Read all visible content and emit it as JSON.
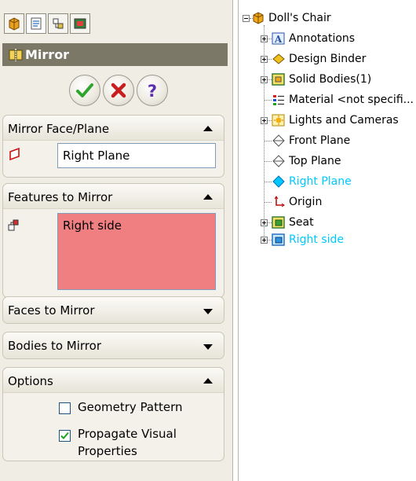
{
  "panel": {
    "tabs": [
      {
        "icon": "feature-manager-icon"
      },
      {
        "icon": "property-manager-icon"
      },
      {
        "icon": "configuration-manager-icon"
      },
      {
        "icon": "display-manager-icon"
      }
    ],
    "title": "Mirror",
    "actions": {
      "ok": "ok-icon",
      "cancel": "cancel-icon",
      "help": "help-icon"
    },
    "groups": {
      "mirror_face": {
        "label": "Mirror Face/Plane",
        "value": "Right Plane"
      },
      "features": {
        "label": "Features to Mirror",
        "value": "Right side"
      },
      "faces": {
        "label": "Faces to Mirror"
      },
      "bodies": {
        "label": "Bodies to Mirror"
      },
      "options": {
        "label": "Options",
        "geometry_pattern": {
          "label": "Geometry Pattern",
          "checked": false
        },
        "propagate": {
          "label_line1": "Propagate Visual",
          "label_line2": "Properties",
          "checked": true
        }
      }
    }
  },
  "tree": {
    "root": "Doll's Chair",
    "items": [
      {
        "label": "Annotations",
        "icon": "annotations-icon"
      },
      {
        "label": "Design Binder",
        "icon": "design-binder-icon"
      },
      {
        "label": "Solid Bodies(1)",
        "icon": "solid-bodies-icon"
      },
      {
        "label": "Material <not specifi...",
        "icon": "material-icon"
      },
      {
        "label": "Lights and Cameras",
        "icon": "lights-icon"
      },
      {
        "label": "Front Plane",
        "icon": "plane-icon"
      },
      {
        "label": "Top Plane",
        "icon": "plane-icon"
      },
      {
        "label": "Right Plane",
        "icon": "plane-icon"
      },
      {
        "label": "Origin",
        "icon": "origin-icon"
      },
      {
        "label": "Seat",
        "icon": "extrude-icon"
      },
      {
        "label": "Right side",
        "icon": "extrude-icon"
      }
    ]
  },
  "colors": {
    "highlight": "#00c8ff",
    "selection_fill": "#f07f82",
    "title_bar": "#7b7867"
  }
}
